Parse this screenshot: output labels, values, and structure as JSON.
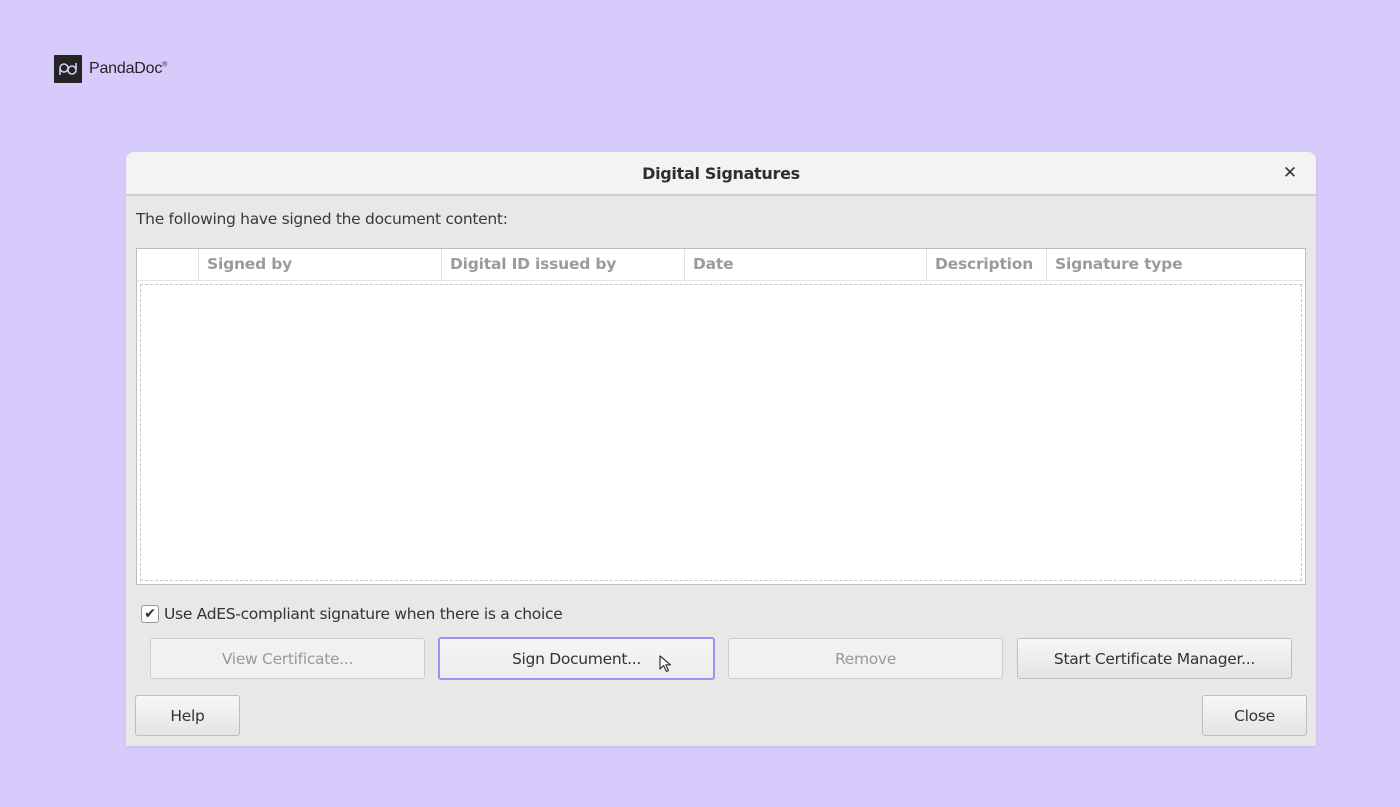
{
  "brand": {
    "name": "PandaDoc",
    "mark": "registered"
  },
  "dialog": {
    "title": "Digital Signatures",
    "close_icon": "close-icon",
    "intro_text": "The following have signed the document content:",
    "table": {
      "columns": [
        "",
        "Signed by",
        "Digital ID issued by",
        "Date",
        "Description",
        "Signature type"
      ],
      "rows": []
    },
    "ades_checkbox": {
      "label": "Use AdES-compliant signature when there is a choice",
      "checked": true
    },
    "buttons": {
      "view_certificate": {
        "label": "View Certificate...",
        "enabled": false
      },
      "sign_document": {
        "label": "Sign Document...",
        "enabled": true,
        "focused": true
      },
      "remove": {
        "label": "Remove",
        "enabled": false
      },
      "start_certificate_manager": {
        "label": "Start Certificate Manager...",
        "enabled": true
      },
      "help": {
        "label": "Help"
      },
      "close": {
        "label": "Close"
      }
    },
    "colors": {
      "focus_ring": "#a48cf3",
      "page_background": "#d6cbfb"
    }
  }
}
